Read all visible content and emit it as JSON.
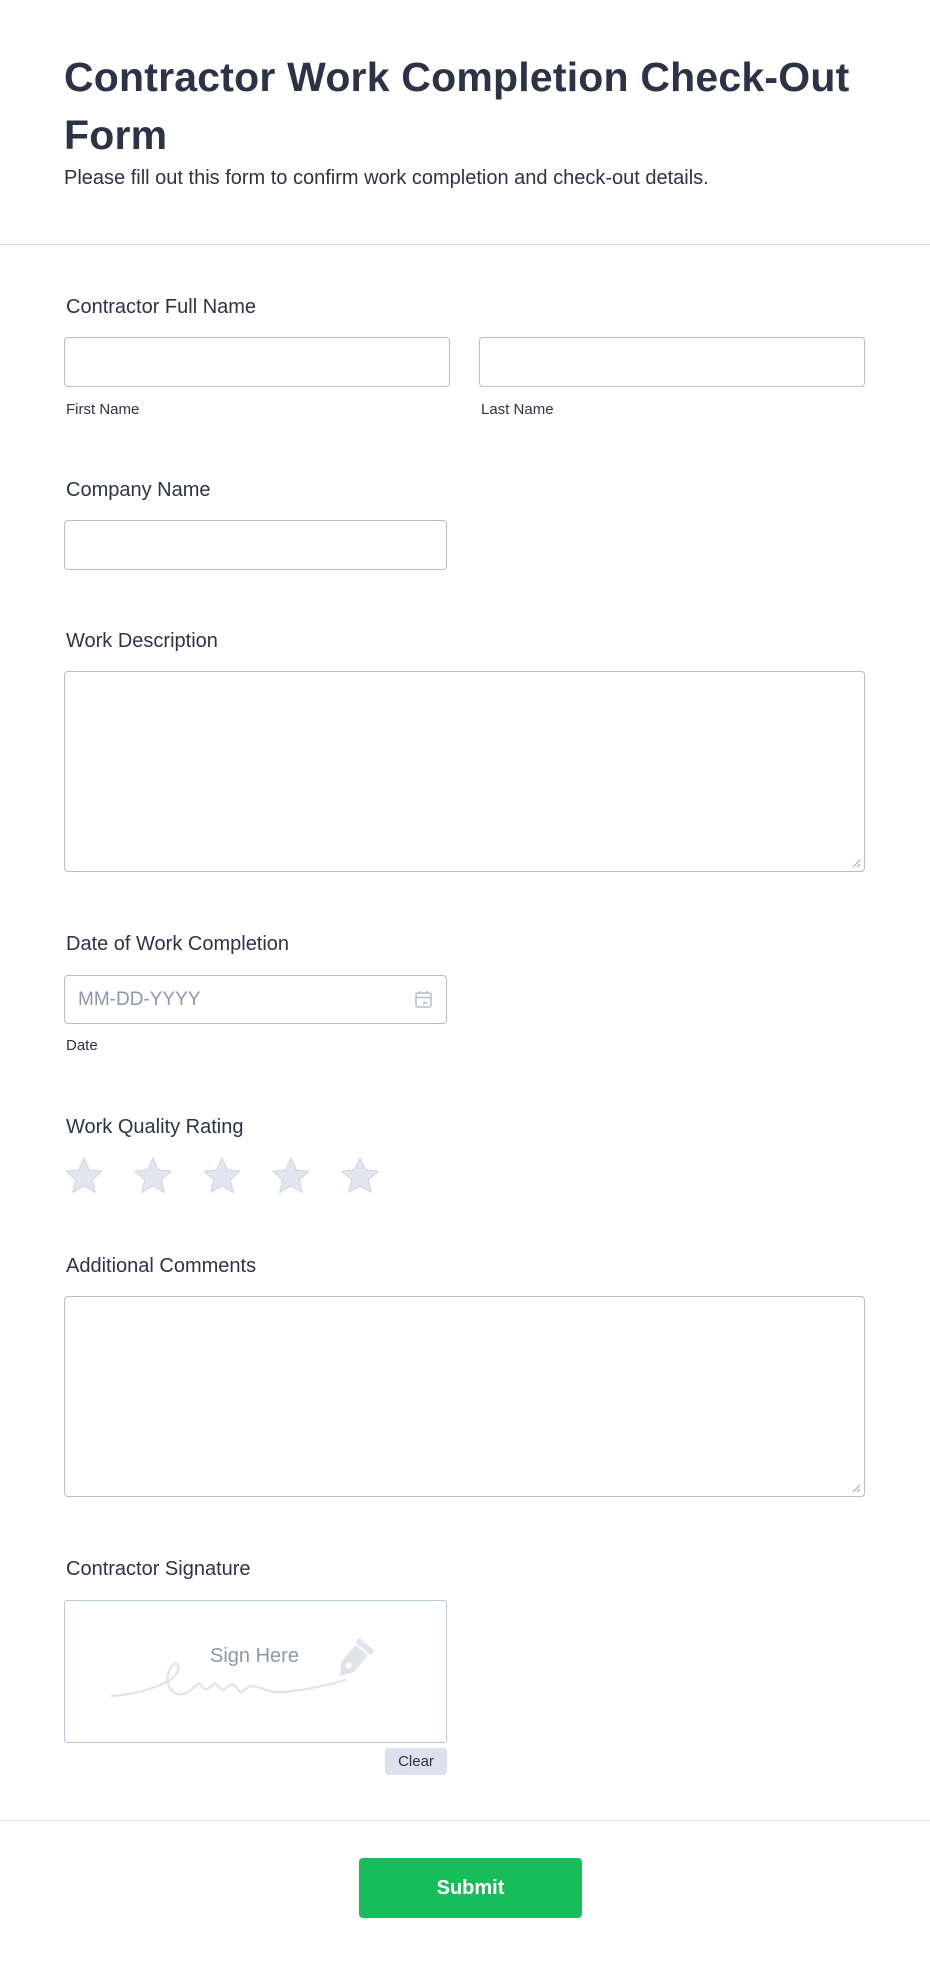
{
  "header": {
    "title": "Contractor Work Completion Check-Out Form",
    "subtitle": "Please fill out this form to confirm work completion and check-out details."
  },
  "fields": {
    "full_name": {
      "label": "Contractor Full Name",
      "first_sublabel": "First Name",
      "last_sublabel": "Last Name",
      "first_value": "",
      "last_value": ""
    },
    "company": {
      "label": "Company Name",
      "value": ""
    },
    "work_description": {
      "label": "Work Description",
      "value": ""
    },
    "completion_date": {
      "label": "Date of Work Completion",
      "placeholder": "MM-DD-YYYY",
      "sublabel": "Date"
    },
    "rating": {
      "label": "Work Quality Rating",
      "max": 5,
      "value": 0
    },
    "comments": {
      "label": "Additional Comments",
      "value": ""
    },
    "signature": {
      "label": "Contractor Signature",
      "placeholder": "Sign Here",
      "clear_label": "Clear"
    }
  },
  "submit_label": "Submit",
  "colors": {
    "text": "#2c3345",
    "border": "#b8bdc9",
    "placeholder": "#8d96aa",
    "star": "#e3e6f0",
    "submit": "#18bd5b"
  }
}
